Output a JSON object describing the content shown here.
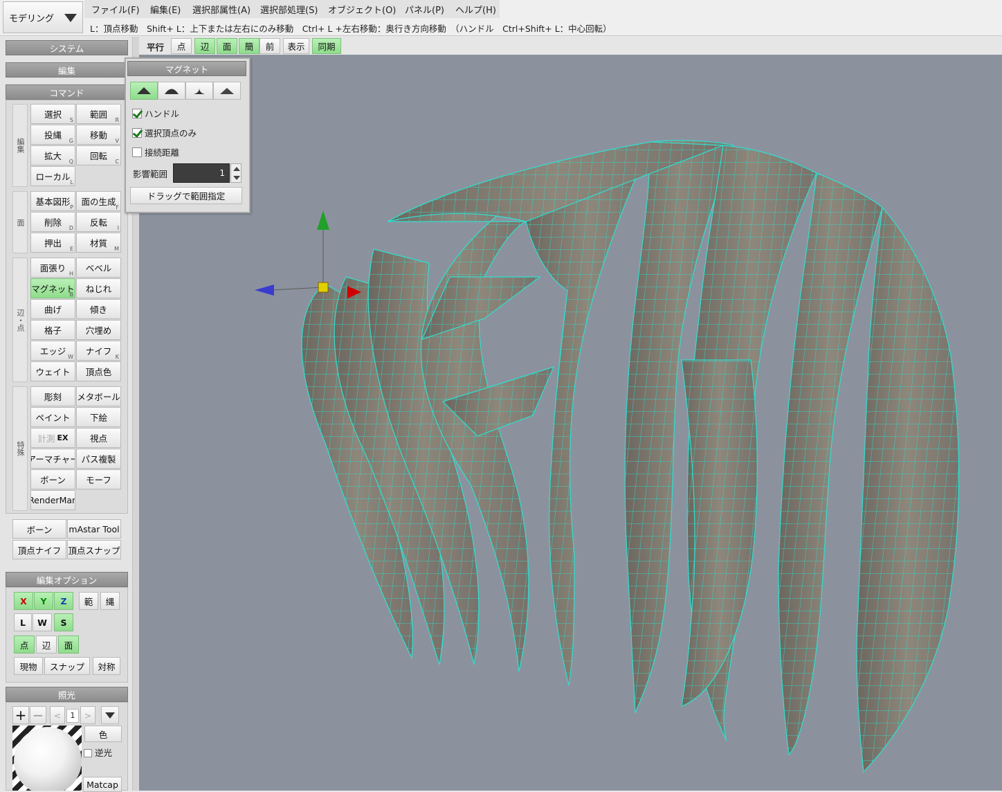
{
  "mode_select": {
    "value": "モデリング"
  },
  "menu": [
    "ファイル(F)",
    "編集(E)",
    "選択部属性(A)",
    "選択部処理(S)",
    "オブジェクト(O)",
    "パネル(P)",
    "ヘルプ(H)"
  ],
  "hint": "L：頂点移動　Shift+ L：上下または左右にのみ移動　Ctrl+ L +左右移動：奥行き方向移動　（ハンドル　Ctrl+Shift+ L：中心回転）",
  "view_toolbar": {
    "title": "平行",
    "buttons": [
      "点",
      "辺",
      "面",
      "簡",
      "前",
      "表示",
      "同期"
    ]
  },
  "left": {
    "system": "システム",
    "edit": "編集",
    "command": "コマンド",
    "groups": {
      "edit": "編集",
      "face": "面",
      "edge": "辺・点",
      "special": "特殊"
    },
    "cmd_rows": [
      [
        {
          "t": "選択",
          "k": "S"
        },
        {
          "t": "範囲",
          "k": "R"
        }
      ],
      [
        {
          "t": "投縄",
          "k": "G"
        },
        {
          "t": "移動",
          "k": "V"
        }
      ],
      [
        {
          "t": "拡大",
          "k": "Q"
        },
        {
          "t": "回転",
          "k": "C"
        }
      ],
      [
        {
          "t": "ローカル",
          "k": "L"
        }
      ],
      [
        {
          "t": "基本図形",
          "k": "P"
        },
        {
          "t": "面の生成",
          "k": "F"
        }
      ],
      [
        {
          "t": "削除",
          "k": "D"
        },
        {
          "t": "反転",
          "k": "I"
        }
      ],
      [
        {
          "t": "押出",
          "k": "E"
        },
        {
          "t": "材質",
          "k": "M"
        }
      ],
      [
        {
          "t": "面張り",
          "k": "H"
        },
        {
          "t": "ベベル",
          "k": ""
        }
      ],
      [
        {
          "t": "マグネット",
          "k": "B"
        },
        {
          "t": "ねじれ",
          "k": ""
        }
      ],
      [
        {
          "t": "曲げ",
          "k": ""
        },
        {
          "t": "傾き",
          "k": ""
        }
      ],
      [
        {
          "t": "格子",
          "k": ""
        },
        {
          "t": "穴埋め",
          "k": ""
        }
      ],
      [
        {
          "t": "エッジ",
          "k": "W"
        },
        {
          "t": "ナイフ",
          "k": "K"
        }
      ],
      [
        {
          "t": "ウェイト",
          "k": ""
        },
        {
          "t": "頂点色",
          "k": ""
        }
      ],
      [
        {
          "t": "彫刻",
          "k": ""
        },
        {
          "t": "メタボール",
          "k": ""
        }
      ],
      [
        {
          "t": "ペイント",
          "k": ""
        },
        {
          "t": "下絵",
          "k": ""
        }
      ],
      [
        {
          "t": "計測",
          "k": "EX"
        },
        {
          "t": "視点",
          "k": ""
        }
      ],
      [
        {
          "t": "アーマチャー",
          "k": ""
        },
        {
          "t": "パス複製",
          "k": ""
        }
      ],
      [
        {
          "t": "ボーン",
          "k": ""
        },
        {
          "t": "モーフ",
          "k": ""
        }
      ],
      [
        {
          "t": "RenderMan",
          "k": ""
        }
      ]
    ],
    "plugins": [
      "ボーン",
      "mAstar Tool",
      "頂点ナイフ",
      "頂点スナップ"
    ],
    "edit_options": {
      "title": "編集オプション",
      "axes": [
        "X",
        "Y",
        "Z"
      ],
      "range": "範",
      "lasso": "縄",
      "lws": [
        "L",
        "W",
        "S"
      ],
      "sel": [
        "点",
        "辺",
        "面"
      ],
      "bottom": [
        "現物",
        "スナップ",
        "対称"
      ]
    },
    "light": {
      "title": "照光",
      "index": "1",
      "color": "色",
      "backlight": "逆光",
      "matcap": "Matcap"
    }
  },
  "magnet": {
    "title": "マグネット",
    "handle": "ハンドル",
    "selected_only": "選択頂点のみ",
    "connected": "接続距離",
    "range_label": "影響範囲",
    "range_value": "1",
    "drag_button": "ドラッグで範囲指定"
  },
  "colors": {
    "accent": "#96de93",
    "wire": "#2ee0d0",
    "mesh": "#857f74",
    "viewport": "#8b929e"
  }
}
